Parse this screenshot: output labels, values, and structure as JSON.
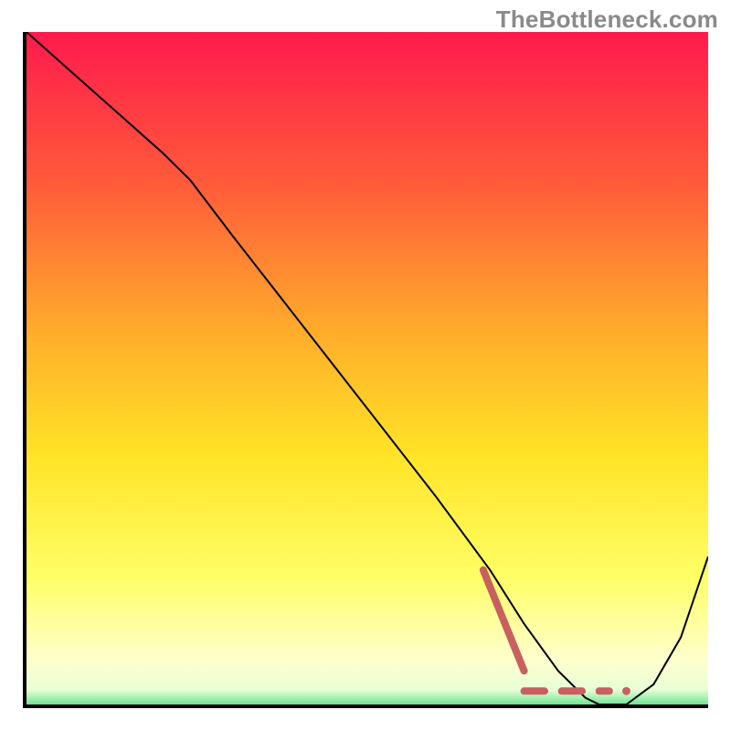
{
  "watermark": "TheBottleneck.com",
  "chart_data": {
    "type": "line",
    "title": "",
    "xlabel": "",
    "ylabel": "",
    "xlim": [
      0,
      100
    ],
    "ylim": [
      0,
      100
    ],
    "grid": false,
    "gradient_stops": [
      {
        "offset": 0.0,
        "color": "#ff1a4d"
      },
      {
        "offset": 0.22,
        "color": "#ff5a3a"
      },
      {
        "offset": 0.45,
        "color": "#ffb02a"
      },
      {
        "offset": 0.62,
        "color": "#ffe326"
      },
      {
        "offset": 0.8,
        "color": "#ffff66"
      },
      {
        "offset": 0.92,
        "color": "#ffffcc"
      },
      {
        "offset": 0.965,
        "color": "#e8ffd6"
      },
      {
        "offset": 1.0,
        "color": "#23d36b"
      }
    ],
    "series": [
      {
        "name": "bottleneck-curve",
        "color": "#000000",
        "width": 2,
        "x": [
          0,
          10,
          20,
          24,
          30,
          40,
          50,
          60,
          68,
          73,
          78,
          82,
          84,
          88,
          92,
          96,
          100
        ],
        "y": [
          100,
          91,
          82,
          78,
          70,
          57,
          44,
          31,
          20,
          12,
          5,
          1,
          0,
          0,
          3,
          10,
          22
        ]
      },
      {
        "name": "optimal-zone-markers",
        "color": "#c86060",
        "width": 8,
        "segments": [
          {
            "x": [
              67,
              73
            ],
            "y": [
              20,
              5
            ]
          },
          {
            "x": [
              73,
              76
            ],
            "y": [
              2,
              2
            ]
          },
          {
            "x": [
              78.5,
              81.5
            ],
            "y": [
              2,
              2
            ]
          },
          {
            "x": [
              84,
              85.5
            ],
            "y": [
              2,
              2
            ]
          }
        ],
        "dots": [
          {
            "x": 88,
            "y": 2
          }
        ]
      }
    ]
  }
}
